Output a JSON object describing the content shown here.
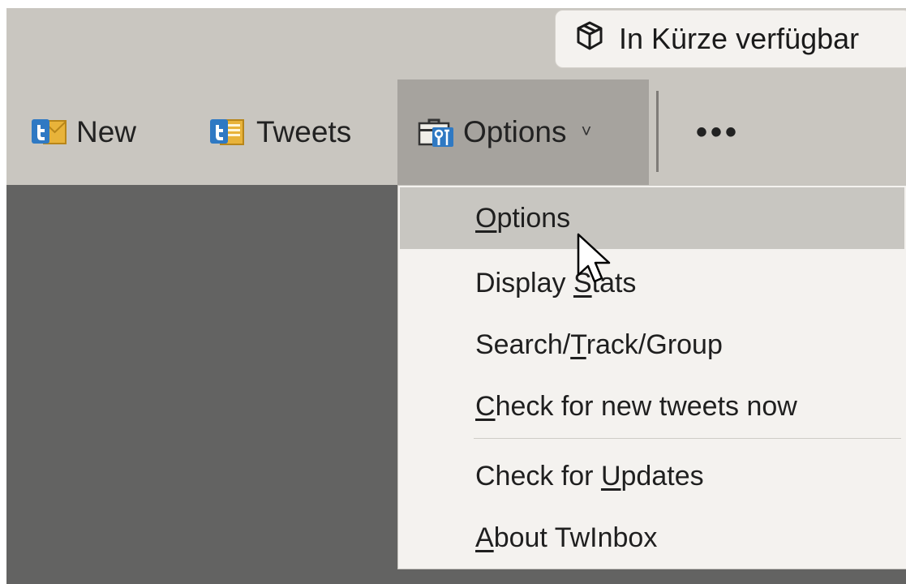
{
  "toolbar": {
    "soon_label": "In Kürze verfügbar",
    "new_label": "New",
    "tweets_label": "Tweets",
    "options_label": "Options",
    "options_chevron": "˅",
    "more_label": "•••"
  },
  "options_menu": {
    "items": [
      {
        "before": "",
        "key": "O",
        "after": "ptions"
      },
      {
        "before": "Display ",
        "key": "S",
        "after": "tats"
      },
      {
        "before": "Search/",
        "key": "T",
        "after": "rack/Group"
      },
      {
        "before": "",
        "key": "C",
        "after": "heck for new tweets now"
      },
      {
        "before": "Check for ",
        "key": "U",
        "after": "pdates"
      },
      {
        "before": "",
        "key": "A",
        "after": "bout TwInbox"
      }
    ]
  },
  "icons": {
    "soon": "package-box-icon",
    "new": "twitter-new-mail-icon",
    "tweets": "twitter-tweets-folder-icon",
    "options": "toolbox-settings-icon",
    "cursor": "mouse-cursor-icon"
  },
  "colors": {
    "toolbar_bg": "#c9c6c0",
    "options_active_bg": "#a6a39e",
    "menu_bg": "#f4f2ef",
    "menu_hover_bg": "#c8c6c1",
    "workspace_bg": "#636362",
    "icon_blue": "#2f79c3",
    "icon_gold": "#e2a92a"
  }
}
